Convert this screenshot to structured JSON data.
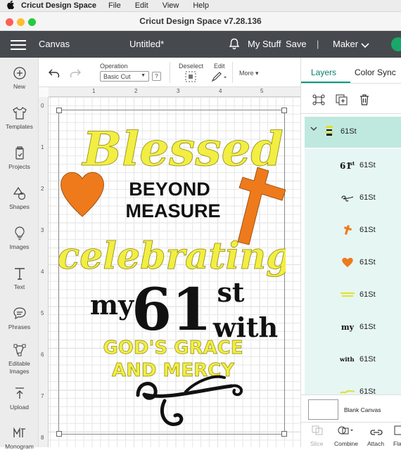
{
  "menubar": {
    "apple": "",
    "app_name": "Cricut Design Space",
    "items": [
      "File",
      "Edit",
      "View",
      "Help"
    ]
  },
  "window": {
    "title": "Cricut Design Space  v7.28.136"
  },
  "header": {
    "canvas_label": "Canvas",
    "doc_title": "Untitled*",
    "my_stuff": "My Stuff",
    "save": "Save",
    "separator": "|",
    "machine": "Maker"
  },
  "leftbar": {
    "items": [
      {
        "label": "New",
        "icon": "plus-circle-icon"
      },
      {
        "label": "Templates",
        "icon": "shirt-icon"
      },
      {
        "label": "Projects",
        "icon": "projects-icon"
      },
      {
        "label": "Shapes",
        "icon": "shapes-icon"
      },
      {
        "label": "Images",
        "icon": "bulb-icon"
      },
      {
        "label": "Text",
        "icon": "text-icon"
      },
      {
        "label": "Phrases",
        "icon": "chat-icon"
      },
      {
        "label": "Editable Images",
        "icon": "editable-images-icon"
      },
      {
        "label": "Upload",
        "icon": "upload-icon"
      },
      {
        "label": "Monogram",
        "icon": "monogram-icon"
      }
    ]
  },
  "toolbar": {
    "operation_label": "Operation",
    "operation_value": "Basic Cut",
    "help": "?",
    "deselect": "Deselect",
    "edit": "Edit",
    "more": "More"
  },
  "rulers": {
    "top": [
      "1",
      "2",
      "3",
      "4",
      "5"
    ],
    "left": [
      "0",
      "1",
      "2",
      "3",
      "4",
      "5",
      "6",
      "7",
      "8"
    ]
  },
  "design": {
    "colors": {
      "yellow": "#f2ee42",
      "orange": "#ee7a1b",
      "black": "#111111"
    },
    "blessed": "Blessed",
    "beyond": "BEYOND",
    "measure": "MEASURE",
    "celebrating": "celebrating",
    "my": "my",
    "num": "61",
    "st": "st",
    "with": "with",
    "graces1": "GOD'S GRACE",
    "graces2": "AND MERCY"
  },
  "rightpanel": {
    "tabs": [
      "Layers",
      "Color Sync"
    ],
    "group_name": "61St",
    "layers": [
      {
        "name": "61St",
        "thumb": "61st"
      },
      {
        "name": "61St",
        "thumb": "swirl"
      },
      {
        "name": "61St",
        "thumb": "cross"
      },
      {
        "name": "61St",
        "thumb": "heart"
      },
      {
        "name": "61St",
        "thumb": "yellow-text"
      },
      {
        "name": "61St",
        "thumb": "my"
      },
      {
        "name": "61St",
        "thumb": "with"
      },
      {
        "name": "61St",
        "thumb": "celebrating"
      }
    ],
    "blank_canvas": "Blank Canvas",
    "bottom_tools": [
      "Slice",
      "Combine",
      "Attach",
      "Fla"
    ]
  }
}
